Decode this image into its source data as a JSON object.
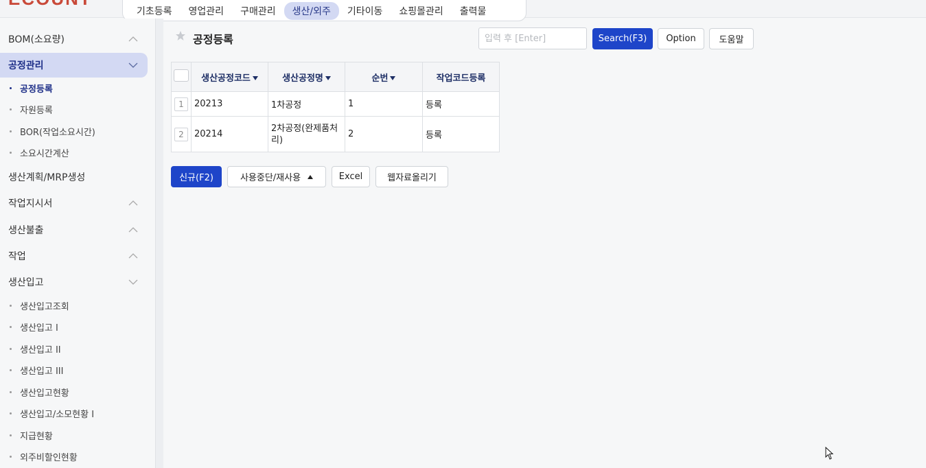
{
  "logo": "ECOUNT",
  "top_menu": [
    {
      "label": "기초등록",
      "active": false
    },
    {
      "label": "영업관리",
      "active": false
    },
    {
      "label": "구매관리",
      "active": false
    },
    {
      "label": "생산/외주",
      "active": true
    },
    {
      "label": "기타이동",
      "active": false
    },
    {
      "label": "쇼핑몰관리",
      "active": false
    },
    {
      "label": "출력물",
      "active": false
    }
  ],
  "sidebar": {
    "groups": [
      {
        "label": "BOM(소요량)",
        "chevron": "up"
      },
      {
        "label": "공정관리",
        "chevron": "down",
        "active": true
      },
      {
        "label": "생산계획/MRP생성",
        "chevron": ""
      },
      {
        "label": "작업지시서",
        "chevron": "up"
      },
      {
        "label": "생산불출",
        "chevron": "up"
      },
      {
        "label": "작업",
        "chevron": "up"
      },
      {
        "label": "생산입고",
        "chevron": "down"
      }
    ],
    "process_items": [
      {
        "label": "공정등록",
        "active": true
      },
      {
        "label": "자원등록"
      },
      {
        "label": "BOR(작업소요시간)"
      },
      {
        "label": "소요시간계산"
      }
    ],
    "receipt_items": [
      {
        "label": "생산입고조회"
      },
      {
        "label": "생산입고 I"
      },
      {
        "label": "생산입고 II"
      },
      {
        "label": "생산입고 III"
      },
      {
        "label": "생산입고현황"
      },
      {
        "label": "생산입고/소모현황 I"
      },
      {
        "label": "지급현황"
      },
      {
        "label": "외주비할인현황"
      }
    ]
  },
  "header": {
    "title": "공정등록",
    "search_placeholder": "입력 후 [Enter]",
    "search_button": "Search(F3)",
    "option_button": "Option",
    "help_button": "도움말"
  },
  "table": {
    "columns": [
      "생산공정코드",
      "생산공정명",
      "순번",
      "작업코드등록"
    ],
    "rows": [
      {
        "num": "1",
        "code": "20213",
        "name": "1차공정",
        "seq": "1",
        "action": "등록"
      },
      {
        "num": "2",
        "code": "20214",
        "name": "2차공정(완제품처리)",
        "seq": "2",
        "action": "등록"
      }
    ]
  },
  "actions": {
    "new": "신규(F2)",
    "toggle_use": "사용중단/재사용",
    "excel": "Excel",
    "upload": "웹자료올리기"
  },
  "colors": {
    "primary": "#1e45c9",
    "active_bg": "#d3d9f3"
  }
}
